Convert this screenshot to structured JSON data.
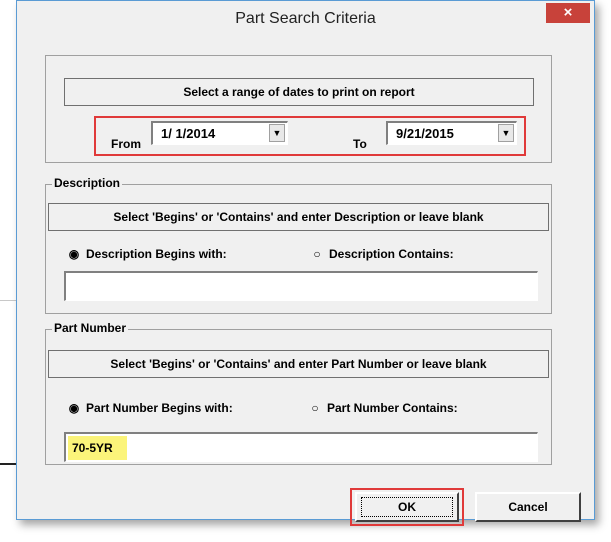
{
  "window": {
    "title": "Part Search Criteria",
    "close_label": "×"
  },
  "dates": {
    "hint": "Select a range of dates to print on report",
    "from_label": "From",
    "from_value": "1/ 1/2014",
    "to_label": "To",
    "to_value": "9/21/2015",
    "dropdown_glyph": "▼"
  },
  "description": {
    "legend": "Description",
    "hint": "Select 'Begins' or 'Contains' and enter Description or leave blank",
    "begins_label": "Description Begins with:",
    "contains_label": "Description Contains:",
    "begins_selected": true,
    "value": ""
  },
  "part_number": {
    "legend": "Part Number",
    "hint": "Select 'Begins' or 'Contains' and enter Part Number or leave blank",
    "begins_label": "Part Number Begins with:",
    "contains_label": "Part Number Contains:",
    "begins_selected": true,
    "value": "70-5YR"
  },
  "buttons": {
    "ok": "OK",
    "cancel": "Cancel"
  },
  "radio_glyphs": {
    "selected": "◉",
    "unselected": "○"
  },
  "colors": {
    "highlight": "#fbf47a",
    "annotation_red": "#e03a3a",
    "close_red": "#c8423a"
  }
}
